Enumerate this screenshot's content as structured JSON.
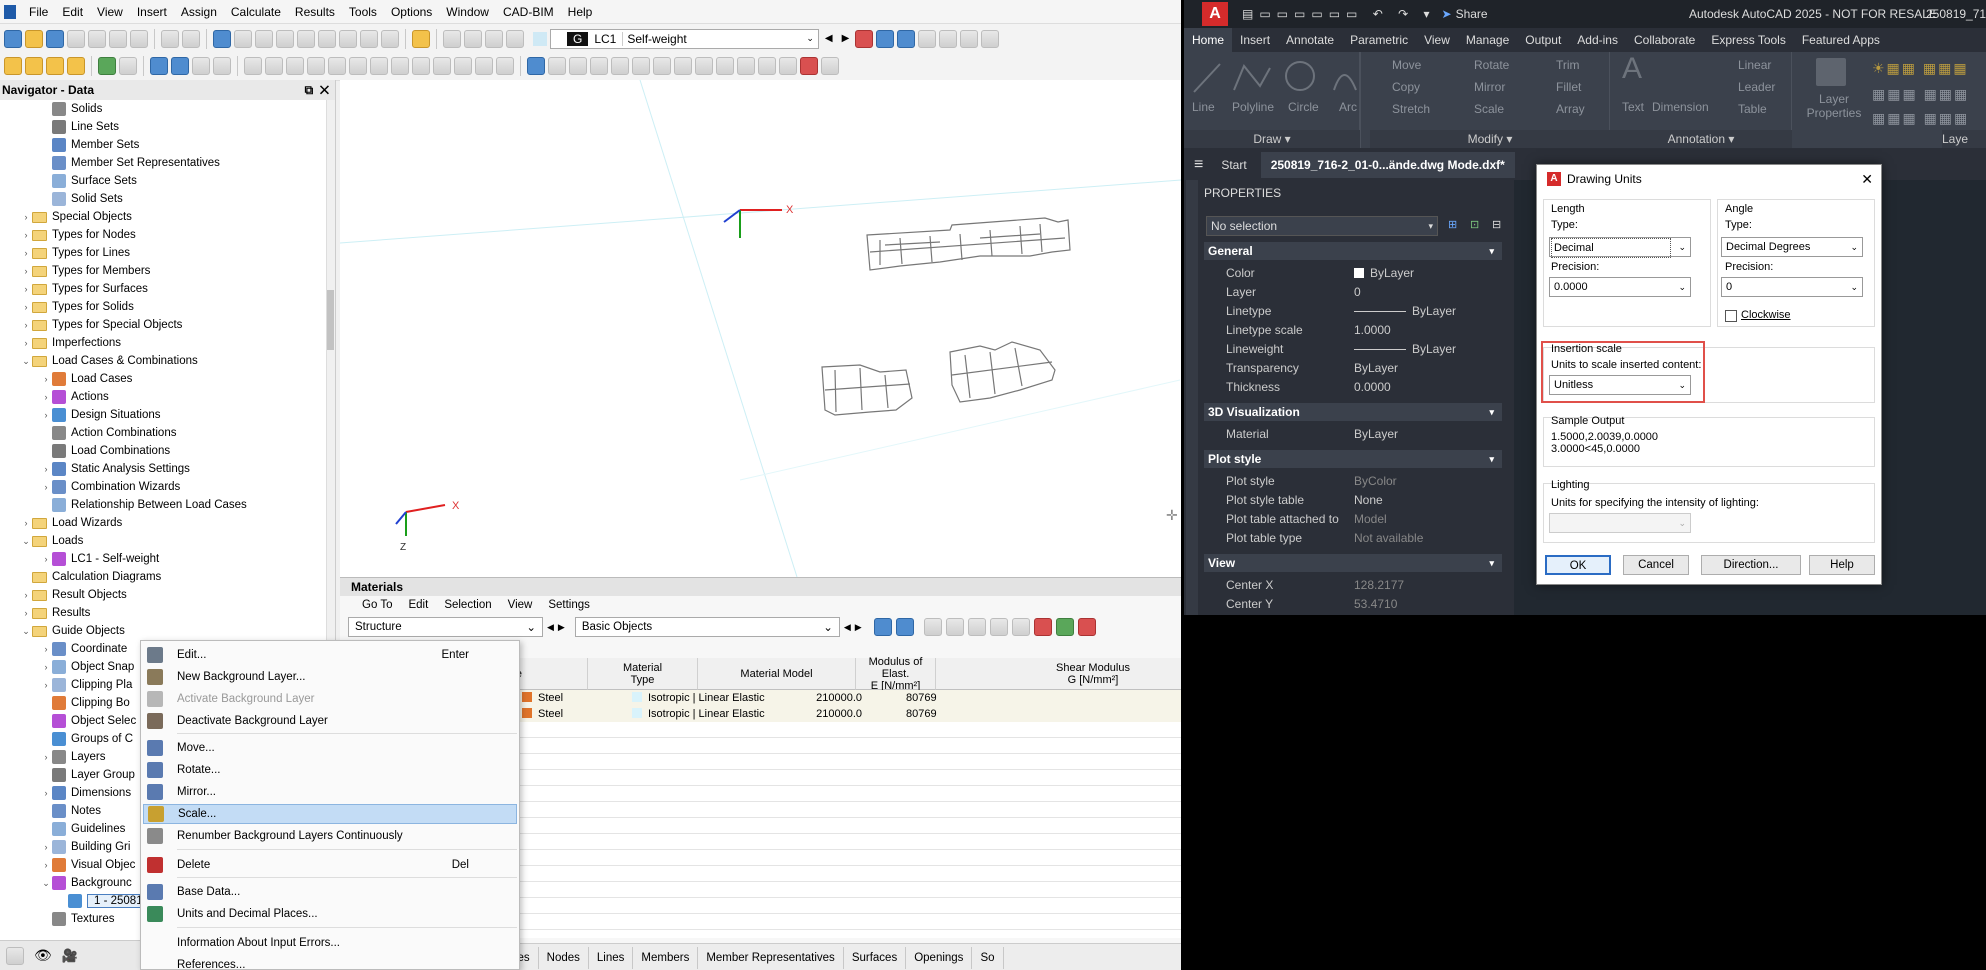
{
  "left_app": {
    "menu": [
      "File",
      "Edit",
      "View",
      "Insert",
      "Assign",
      "Calculate",
      "Results",
      "Tools",
      "Options",
      "Window",
      "CAD-BIM",
      "Help"
    ],
    "toolbar": {
      "lc_badge": "G",
      "lc_code": "LC1",
      "lc_name": "Self-weight"
    },
    "navigator": {
      "title": "Navigator - Data",
      "items": [
        {
          "label": "Solids",
          "level": 2,
          "expand": ""
        },
        {
          "label": "Line Sets",
          "level": 2,
          "expand": ""
        },
        {
          "label": "Member Sets",
          "level": 2,
          "expand": ""
        },
        {
          "label": "Member Set Representatives",
          "level": 2,
          "expand": ""
        },
        {
          "label": "Surface Sets",
          "level": 2,
          "expand": ""
        },
        {
          "label": "Solid Sets",
          "level": 2,
          "expand": ""
        },
        {
          "label": "Special Objects",
          "level": 1,
          "expand": "›"
        },
        {
          "label": "Types for Nodes",
          "level": 1,
          "expand": "›"
        },
        {
          "label": "Types for Lines",
          "level": 1,
          "expand": "›"
        },
        {
          "label": "Types for Members",
          "level": 1,
          "expand": "›"
        },
        {
          "label": "Types for Surfaces",
          "level": 1,
          "expand": "›"
        },
        {
          "label": "Types for Solids",
          "level": 1,
          "expand": "›"
        },
        {
          "label": "Types for Special Objects",
          "level": 1,
          "expand": "›"
        },
        {
          "label": "Imperfections",
          "level": 1,
          "expand": "›"
        },
        {
          "label": "Load Cases & Combinations",
          "level": 1,
          "expand": "⌄"
        },
        {
          "label": "Load Cases",
          "level": 2,
          "expand": "›"
        },
        {
          "label": "Actions",
          "level": 2,
          "expand": "›"
        },
        {
          "label": "Design Situations",
          "level": 2,
          "expand": "›"
        },
        {
          "label": "Action Combinations",
          "level": 2,
          "expand": ""
        },
        {
          "label": "Load Combinations",
          "level": 2,
          "expand": ""
        },
        {
          "label": "Static Analysis Settings",
          "level": 2,
          "expand": "›"
        },
        {
          "label": "Combination Wizards",
          "level": 2,
          "expand": "›"
        },
        {
          "label": "Relationship Between Load Cases",
          "level": 2,
          "expand": ""
        },
        {
          "label": "Load Wizards",
          "level": 1,
          "expand": "›"
        },
        {
          "label": "Loads",
          "level": 1,
          "expand": "⌄"
        },
        {
          "label": "LC1 - Self-weight",
          "level": 2,
          "expand": "›"
        },
        {
          "label": "Calculation Diagrams",
          "level": 1,
          "expand": ""
        },
        {
          "label": "Result Objects",
          "level": 1,
          "expand": "›"
        },
        {
          "label": "Results",
          "level": 1,
          "expand": "›"
        },
        {
          "label": "Guide Objects",
          "level": 1,
          "expand": "⌄"
        },
        {
          "label": "Coordinate",
          "level": 2,
          "expand": "›"
        },
        {
          "label": "Object Snap",
          "level": 2,
          "expand": "›"
        },
        {
          "label": "Clipping Pla",
          "level": 2,
          "expand": "›"
        },
        {
          "label": "Clipping Bo",
          "level": 2,
          "expand": ""
        },
        {
          "label": "Object Selec",
          "level": 2,
          "expand": ""
        },
        {
          "label": "Groups of C",
          "level": 2,
          "expand": ""
        },
        {
          "label": "Layers",
          "level": 2,
          "expand": "›"
        },
        {
          "label": "Layer Group",
          "level": 2,
          "expand": ""
        },
        {
          "label": "Dimensions",
          "level": 2,
          "expand": "›"
        },
        {
          "label": "Notes",
          "level": 2,
          "expand": ""
        },
        {
          "label": "Guidelines",
          "level": 2,
          "expand": ""
        },
        {
          "label": "Building Gri",
          "level": 2,
          "expand": "›"
        },
        {
          "label": "Visual Objec",
          "level": 2,
          "expand": "›"
        },
        {
          "label": "Backgrounc",
          "level": 2,
          "expand": "⌄"
        },
        {
          "label": "1 - 25081",
          "level": 3,
          "expand": ""
        },
        {
          "label": "Textures",
          "level": 2,
          "expand": ""
        }
      ]
    },
    "view": {
      "axis_x": "X",
      "axis_y": "Y",
      "axis_z": "Z"
    },
    "materials": {
      "title": "Materials",
      "menu": [
        "Go To",
        "Edit",
        "Selection",
        "View",
        "Settings"
      ],
      "filter1": "Structure",
      "filter2": "Basic Objects",
      "columns": [
        {
          "h1": "",
          "h2": "rial Name"
        },
        {
          "h1": "Material",
          "h2": "Type"
        },
        {
          "h1": "",
          "h2": "Material Model"
        },
        {
          "h1": "Modulus of Elast.",
          "h2": "E [N/mm²]"
        },
        {
          "h1": "Shear Modulus",
          "h2": "G [N/mm²]"
        }
      ],
      "rows": [
        {
          "type": "Steel",
          "model": "Isotropic | Linear Elastic",
          "e": "210000.0",
          "g": "80769"
        },
        {
          "type": "Steel",
          "model": "Isotropic | Linear Elastic",
          "e": "210000.0",
          "g": "80769"
        }
      ],
      "tabs": [
        "s",
        "Cross-Sections",
        "Thicknesses",
        "Nodes",
        "Lines",
        "Members",
        "Member Representatives",
        "Surfaces",
        "Openings",
        "So"
      ]
    },
    "context_menu": [
      {
        "label": "Edit...",
        "shortcut": "Enter",
        "state": "normal"
      },
      {
        "label": "New Background Layer...",
        "shortcut": "",
        "state": "normal"
      },
      {
        "label": "Activate Background Layer",
        "shortcut": "",
        "state": "disabled"
      },
      {
        "label": "Deactivate Background Layer",
        "shortcut": "",
        "state": "normal"
      },
      {
        "label": "Move...",
        "shortcut": "",
        "state": "normal"
      },
      {
        "label": "Rotate...",
        "shortcut": "",
        "state": "normal"
      },
      {
        "label": "Mirror...",
        "shortcut": "",
        "state": "normal"
      },
      {
        "label": "Scale...",
        "shortcut": "",
        "state": "selected"
      },
      {
        "label": "Renumber Background Layers Continuously",
        "shortcut": "",
        "state": "normal"
      },
      {
        "label": "Delete",
        "shortcut": "Del",
        "state": "normal"
      },
      {
        "label": "Base Data...",
        "shortcut": "",
        "state": "normal"
      },
      {
        "label": "Units and Decimal Places...",
        "shortcut": "",
        "state": "normal"
      },
      {
        "label": "Information About Input Errors...",
        "shortcut": "",
        "state": "normal"
      },
      {
        "label": "References...",
        "shortcut": "",
        "state": "normal"
      }
    ]
  },
  "autocad": {
    "share": "Share",
    "title": "Autodesk AutoCAD 2025 - NOT FOR RESALE",
    "title_file": "250819_71",
    "ribbon_tabs": [
      "Home",
      "Insert",
      "Annotate",
      "Parametric",
      "View",
      "Manage",
      "Output",
      "Add-ins",
      "Collaborate",
      "Express Tools",
      "Featured Apps"
    ],
    "ribbon": {
      "draw": [
        "Line",
        "Polyline",
        "Circle",
        "Arc"
      ],
      "modify": [
        "Move",
        "Rotate",
        "Trim",
        "Copy",
        "Mirror",
        "Fillet",
        "Stretch",
        "Scale",
        "Array"
      ],
      "annotation": [
        "Text",
        "Dimension",
        "Linear",
        "Leader",
        "Table"
      ],
      "layers": "Layer Properties",
      "layers_short": "Laye",
      "panels": [
        "Draw",
        "Modify",
        "Annotation"
      ]
    },
    "doc_tabs": [
      "Start",
      "250819_716-2_01-0...ände.dwg Mode.dxf*"
    ],
    "properties": {
      "title": "PROPERTIES",
      "selection": "No selection",
      "sections": [
        {
          "name": "General",
          "rows": [
            [
              "Color",
              "ByLayer"
            ],
            [
              "Layer",
              "0"
            ],
            [
              "Linetype",
              "ByLayer"
            ],
            [
              "Linetype scale",
              "1.0000"
            ],
            [
              "Lineweight",
              "ByLayer"
            ],
            [
              "Transparency",
              "ByLayer"
            ],
            [
              "Thickness",
              "0.0000"
            ]
          ]
        },
        {
          "name": "3D Visualization",
          "rows": [
            [
              "Material",
              "ByLayer"
            ]
          ]
        },
        {
          "name": "Plot style",
          "rows": [
            [
              "Plot style",
              "ByColor"
            ],
            [
              "Plot style table",
              "None"
            ],
            [
              "Plot table attached to",
              "Model"
            ],
            [
              "Plot table type",
              "Not available"
            ]
          ]
        },
        {
          "name": "View",
          "rows": [
            [
              "Center X",
              "128.2177"
            ],
            [
              "Center Y",
              "53.4710"
            ],
            [
              "Center Z",
              "0.0000"
            ]
          ]
        }
      ]
    },
    "dialog": {
      "title": "Drawing Units",
      "length_group": "Length",
      "length_type_label": "Type:",
      "length_type": "Decimal",
      "length_precision_label": "Precision:",
      "length_precision": "0.0000",
      "angle_group": "Angle",
      "angle_type_label": "Type:",
      "angle_type": "Decimal Degrees",
      "angle_precision_label": "Precision:",
      "angle_precision": "0",
      "clockwise": "Clockwise",
      "insertion_group": "Insertion scale",
      "insertion_label": "Units to scale inserted content:",
      "insertion_value": "Unitless",
      "sample_group": "Sample Output",
      "sample_line1": "1.5000,2.0039,0.0000",
      "sample_line2": "3.0000<45,0.0000",
      "lighting_group": "Lighting",
      "lighting_label": "Units for specifying the intensity of lighting:",
      "buttons": [
        "OK",
        "Cancel",
        "Direction...",
        "Help"
      ],
      "highlight_color": "#e0504a"
    }
  }
}
